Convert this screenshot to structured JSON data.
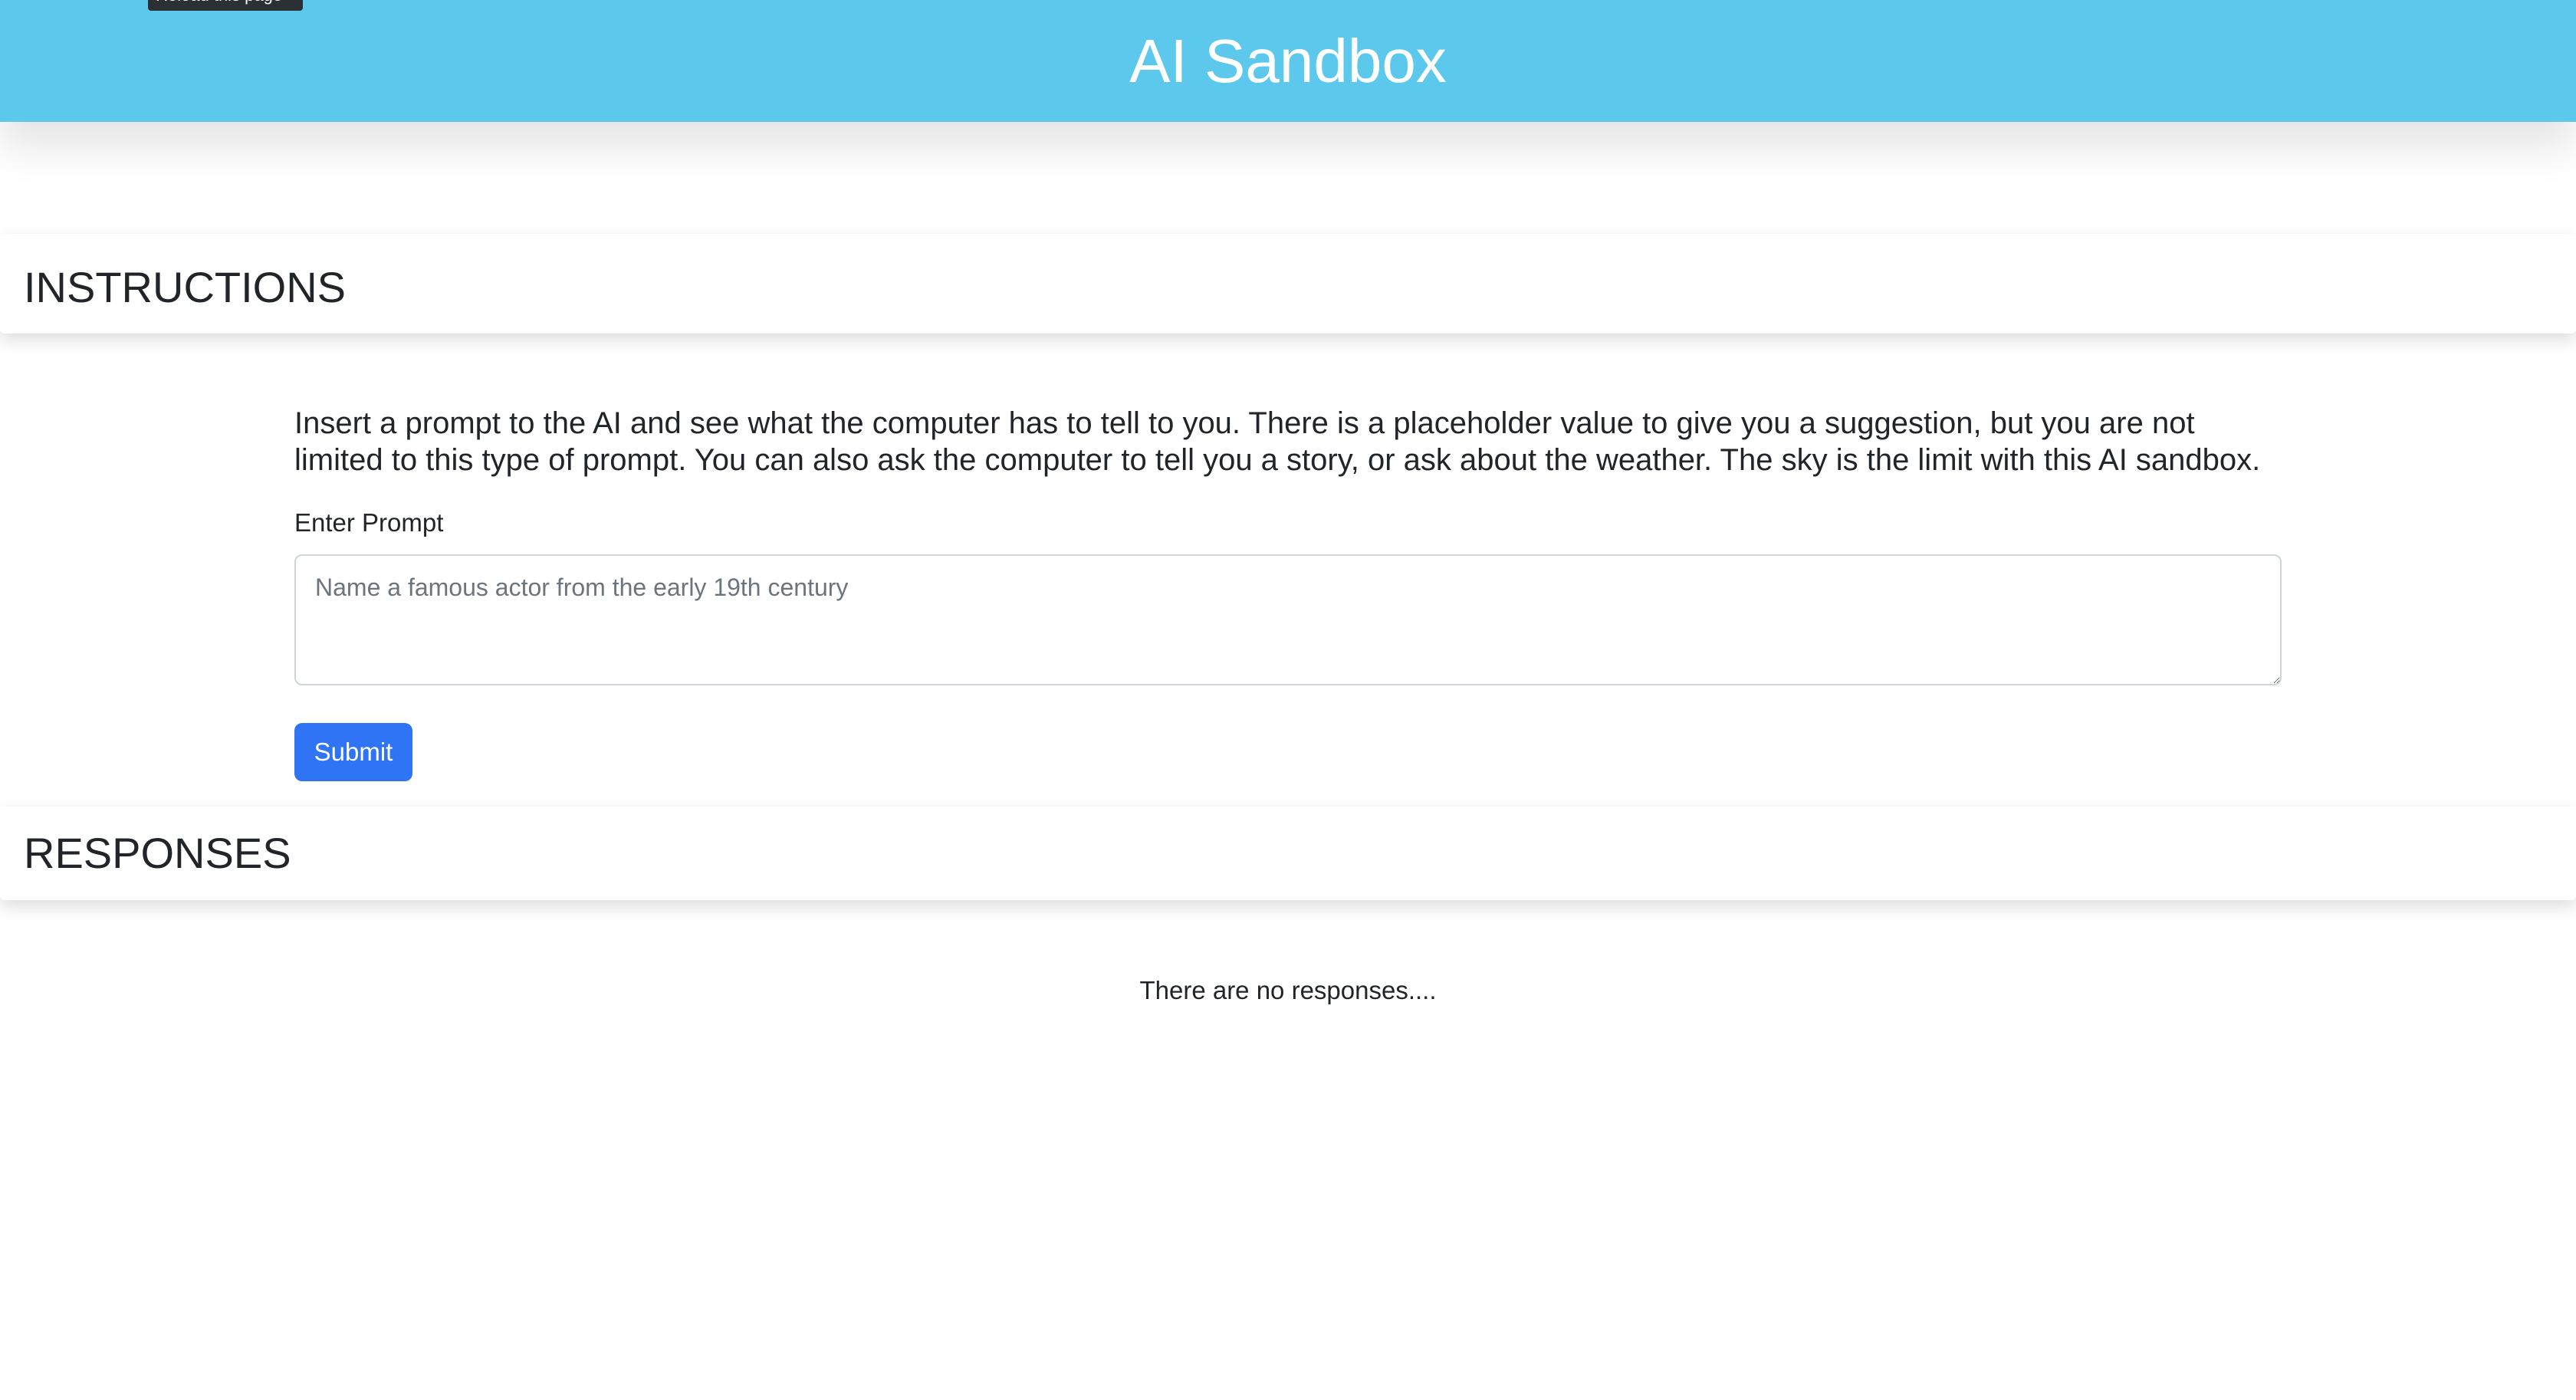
{
  "header": {
    "title": "AI Sandbox",
    "tooltip": "Reload this page"
  },
  "instructions": {
    "title": "INSTRUCTIONS",
    "text": "Insert a prompt to the AI and see what the computer has to tell to you. There is a placeholder value to give you a suggestion, but you are not limited to this type of prompt. You can also ask the computer to tell you a story, or ask about the weather. The sky is the limit with this AI sandbox."
  },
  "form": {
    "label": "Enter Prompt",
    "value": "",
    "placeholder": "Name a famous actor from the early 19th century",
    "submit_label": "Submit"
  },
  "responses": {
    "title": "RESPONSES",
    "empty_text": "There are no responses...."
  },
  "colors": {
    "header_bg": "#5bc8ec",
    "button_bg": "#2f74f5",
    "text": "#212529"
  }
}
